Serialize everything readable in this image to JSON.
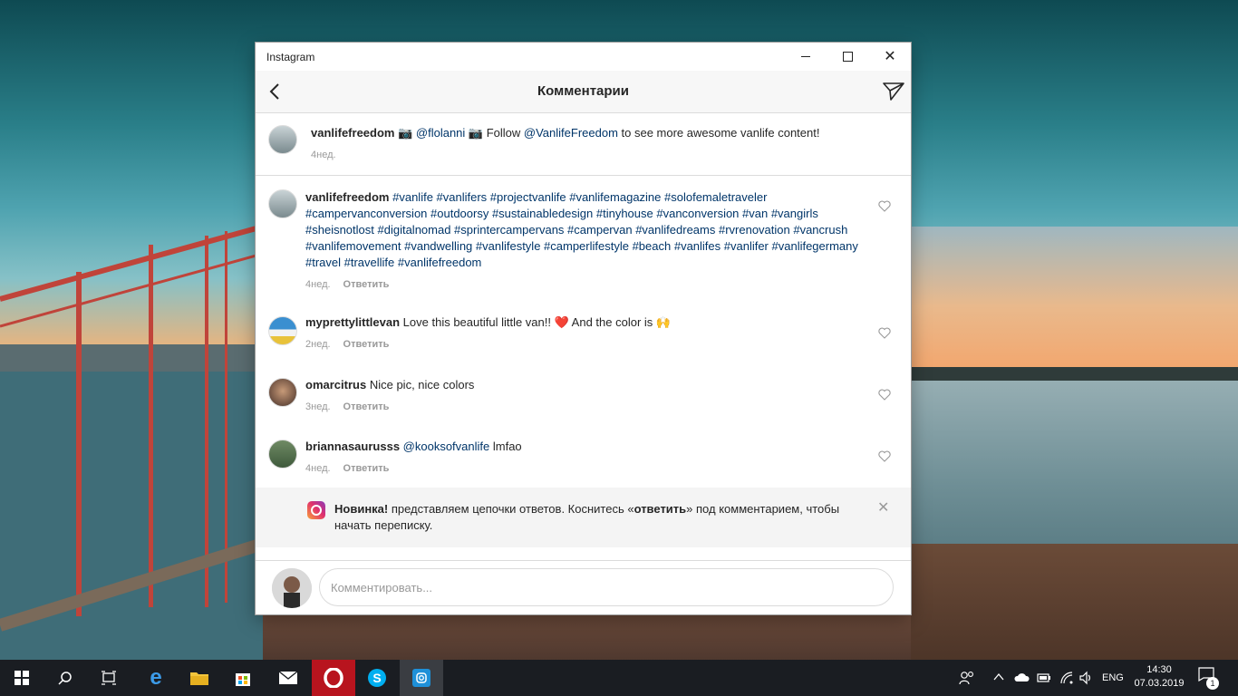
{
  "window": {
    "title": "Instagram"
  },
  "header": {
    "title": "Комментарии"
  },
  "caption": {
    "username": "vanlifefreedom",
    "text_parts": [
      " 📷 ",
      "@flolanni",
      " 📷 Follow ",
      "@VanlifeFreedom",
      " to see more awesome vanlife content!"
    ],
    "time": "4нед."
  },
  "comments": [
    {
      "username": "vanlifefreedom",
      "text": "#vanlife #vanlifers #projectvanlife #vanlifemagazine #solofemaletraveler #campervanconversion #outdoorsy #sustainabledesign #tinyhouse #vanconversion #van #vangirls #sheisnotlost #digitalnomad #sprintercampervans #campervan  #vanlifedreams #rvrenovation #vancrush #vanlifemovement #vandwelling #vanlifestyle #camperlifestyle #beach #vanlifes #vanlifer #vanlifegermany #travel #travellife #vanlifefreedom",
      "time": "4нед.",
      "reply": "Ответить"
    },
    {
      "username": "myprettylittlevan",
      "text": "Love this beautiful little van!! ❤️  And the color is 🙌",
      "time": "2нед.",
      "reply": "Ответить"
    },
    {
      "username": "omarcitrus",
      "text": "Nice pic, nice colors",
      "time": "3нед.",
      "reply": "Ответить"
    },
    {
      "username": "briannasaurusss",
      "mention": "@kooksofvanlife",
      "text": " lmfao",
      "time": "4нед.",
      "reply": "Ответить"
    }
  ],
  "notice": {
    "bold_new": "Новинка!",
    "text1": " представляем цепочки ответов. Коснитесь «",
    "bold_reply": "ответить",
    "text2": "» под комментарием, чтобы начать переписку."
  },
  "composer": {
    "placeholder": "Комментировать..."
  },
  "taskbar": {
    "lang": "ENG",
    "time": "14:30",
    "date": "07.03.2019",
    "notifications": "1"
  },
  "colors": {
    "link": "#003569",
    "muted": "#999999",
    "taskbar": "#1a1d22",
    "opera": "#b8141e"
  }
}
